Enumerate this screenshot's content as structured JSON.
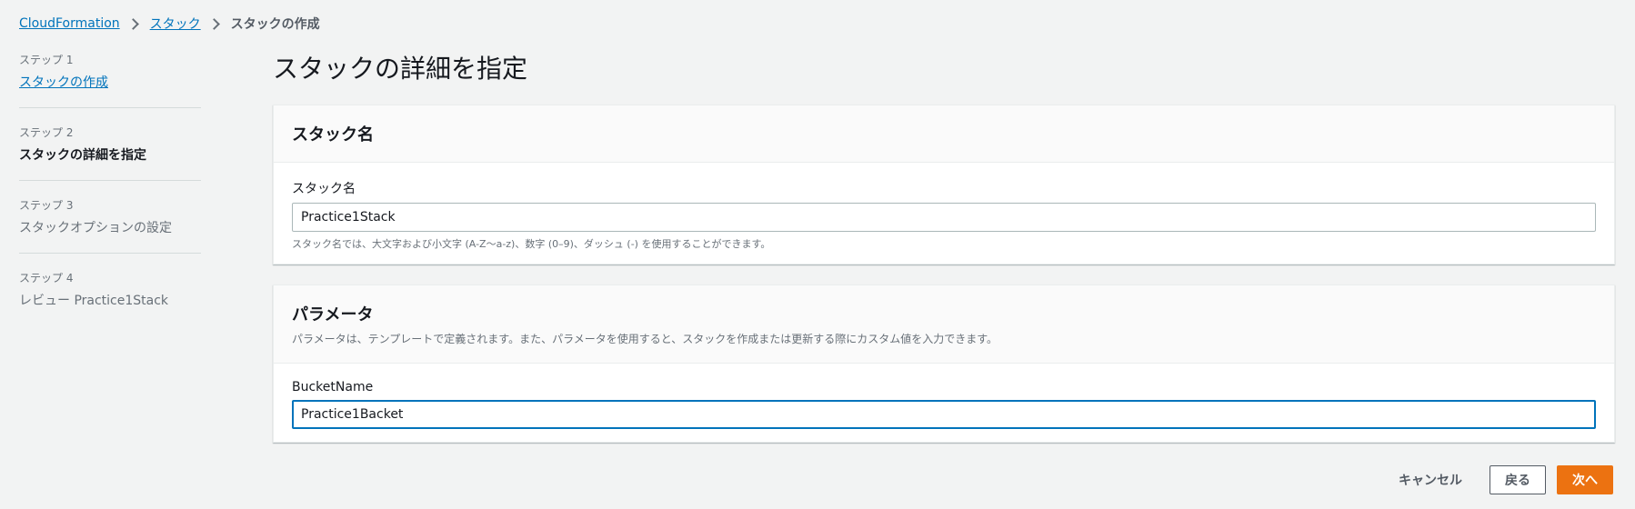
{
  "breadcrumb": {
    "items": [
      "CloudFormation",
      "スタック"
    ],
    "current": "スタックの作成"
  },
  "steps": [
    {
      "number": "ステップ 1",
      "title": "スタックの作成"
    },
    {
      "number": "ステップ 2",
      "title": "スタックの詳細を指定"
    },
    {
      "number": "ステップ 3",
      "title": "スタックオプションの設定"
    },
    {
      "number": "ステップ 4",
      "title": "レビュー Practice1Stack"
    }
  ],
  "page": {
    "title": "スタックの詳細を指定"
  },
  "stack_name_panel": {
    "header": "スタック名",
    "field_label": "スタック名",
    "value": "Practice1Stack",
    "hint": "スタック名では、大文字および小文字 (A-Z〜a-z)、数字 (0–9)、ダッシュ (-) を使用することができます。"
  },
  "parameters_panel": {
    "header": "パラメータ",
    "description": "パラメータは、テンプレートで定義されます。また、パラメータを使用すると、スタックを作成または更新する際にカスタム値を入力できます。",
    "field_label": "BucketName",
    "value": "Practice1Backet"
  },
  "actions": {
    "cancel": "キャンセル",
    "back": "戻る",
    "next": "次へ"
  },
  "colors": {
    "accent": "#0073bb",
    "primary_button": "#ec7211",
    "background": "#f2f3f3"
  }
}
